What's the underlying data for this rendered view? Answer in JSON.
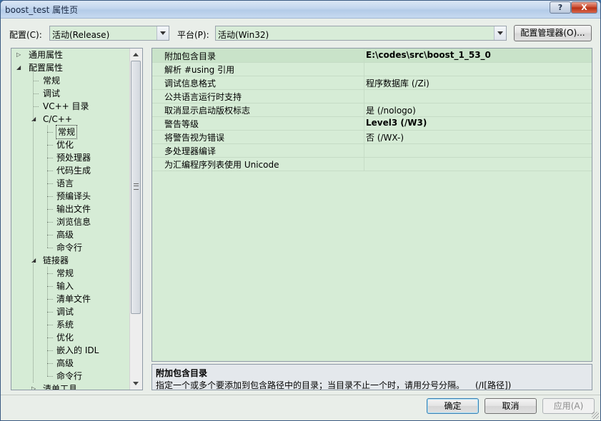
{
  "window": {
    "title": "boost_test 属性页",
    "help_label": "?",
    "close_label": "X"
  },
  "config_bar": {
    "config_label": "配置(C):",
    "config_value": "活动(Release)",
    "platform_label": "平台(P):",
    "platform_value": "活动(Win32)",
    "manager_button": "配置管理器(O)..."
  },
  "tree": {
    "items": [
      {
        "label": "通用属性",
        "expander": "▷"
      },
      {
        "label": "配置属性",
        "expander": "◢"
      },
      {
        "label": "常规"
      },
      {
        "label": "调试"
      },
      {
        "label": "VC++ 目录"
      },
      {
        "label": "C/C++",
        "expander": "◢"
      },
      {
        "label": "常规",
        "selected": true
      },
      {
        "label": "优化"
      },
      {
        "label": "预处理器"
      },
      {
        "label": "代码生成"
      },
      {
        "label": "语言"
      },
      {
        "label": "预编译头"
      },
      {
        "label": "输出文件"
      },
      {
        "label": "浏览信息"
      },
      {
        "label": "高级"
      },
      {
        "label": "命令行"
      },
      {
        "label": "链接器",
        "expander": "◢"
      },
      {
        "label": "常规"
      },
      {
        "label": "输入"
      },
      {
        "label": "清单文件"
      },
      {
        "label": "调试"
      },
      {
        "label": "系统"
      },
      {
        "label": "优化"
      },
      {
        "label": "嵌入的 IDL"
      },
      {
        "label": "高级"
      },
      {
        "label": "命令行"
      },
      {
        "label": "清单工具",
        "expander": "▷"
      }
    ]
  },
  "grid": {
    "rows": [
      {
        "name": "附加包含目录",
        "value": "E:\\codes\\src\\boost_1_53_0",
        "bold": true
      },
      {
        "name": "解析 #using 引用",
        "value": ""
      },
      {
        "name": "调试信息格式",
        "value": "程序数据库 (/Zi)"
      },
      {
        "name": "公共语言运行时支持",
        "value": ""
      },
      {
        "name": "取消显示启动版权标志",
        "value": "是 (/nologo)"
      },
      {
        "name": "警告等级",
        "value": "Level3 (/W3)",
        "bold": true
      },
      {
        "name": "将警告视为错误",
        "value": "否 (/WX-)"
      },
      {
        "name": "多处理器编译",
        "value": ""
      },
      {
        "name": "为汇编程序列表使用 Unicode",
        "value": ""
      }
    ]
  },
  "description": {
    "title": "附加包含目录",
    "text": "指定一个或多个要添加到包含路径中的目录；当目录不止一个时，请用分号分隔。",
    "switch": "(/I[路径])"
  },
  "buttons": {
    "ok": "确定",
    "cancel": "取消",
    "apply": "应用(A)"
  }
}
